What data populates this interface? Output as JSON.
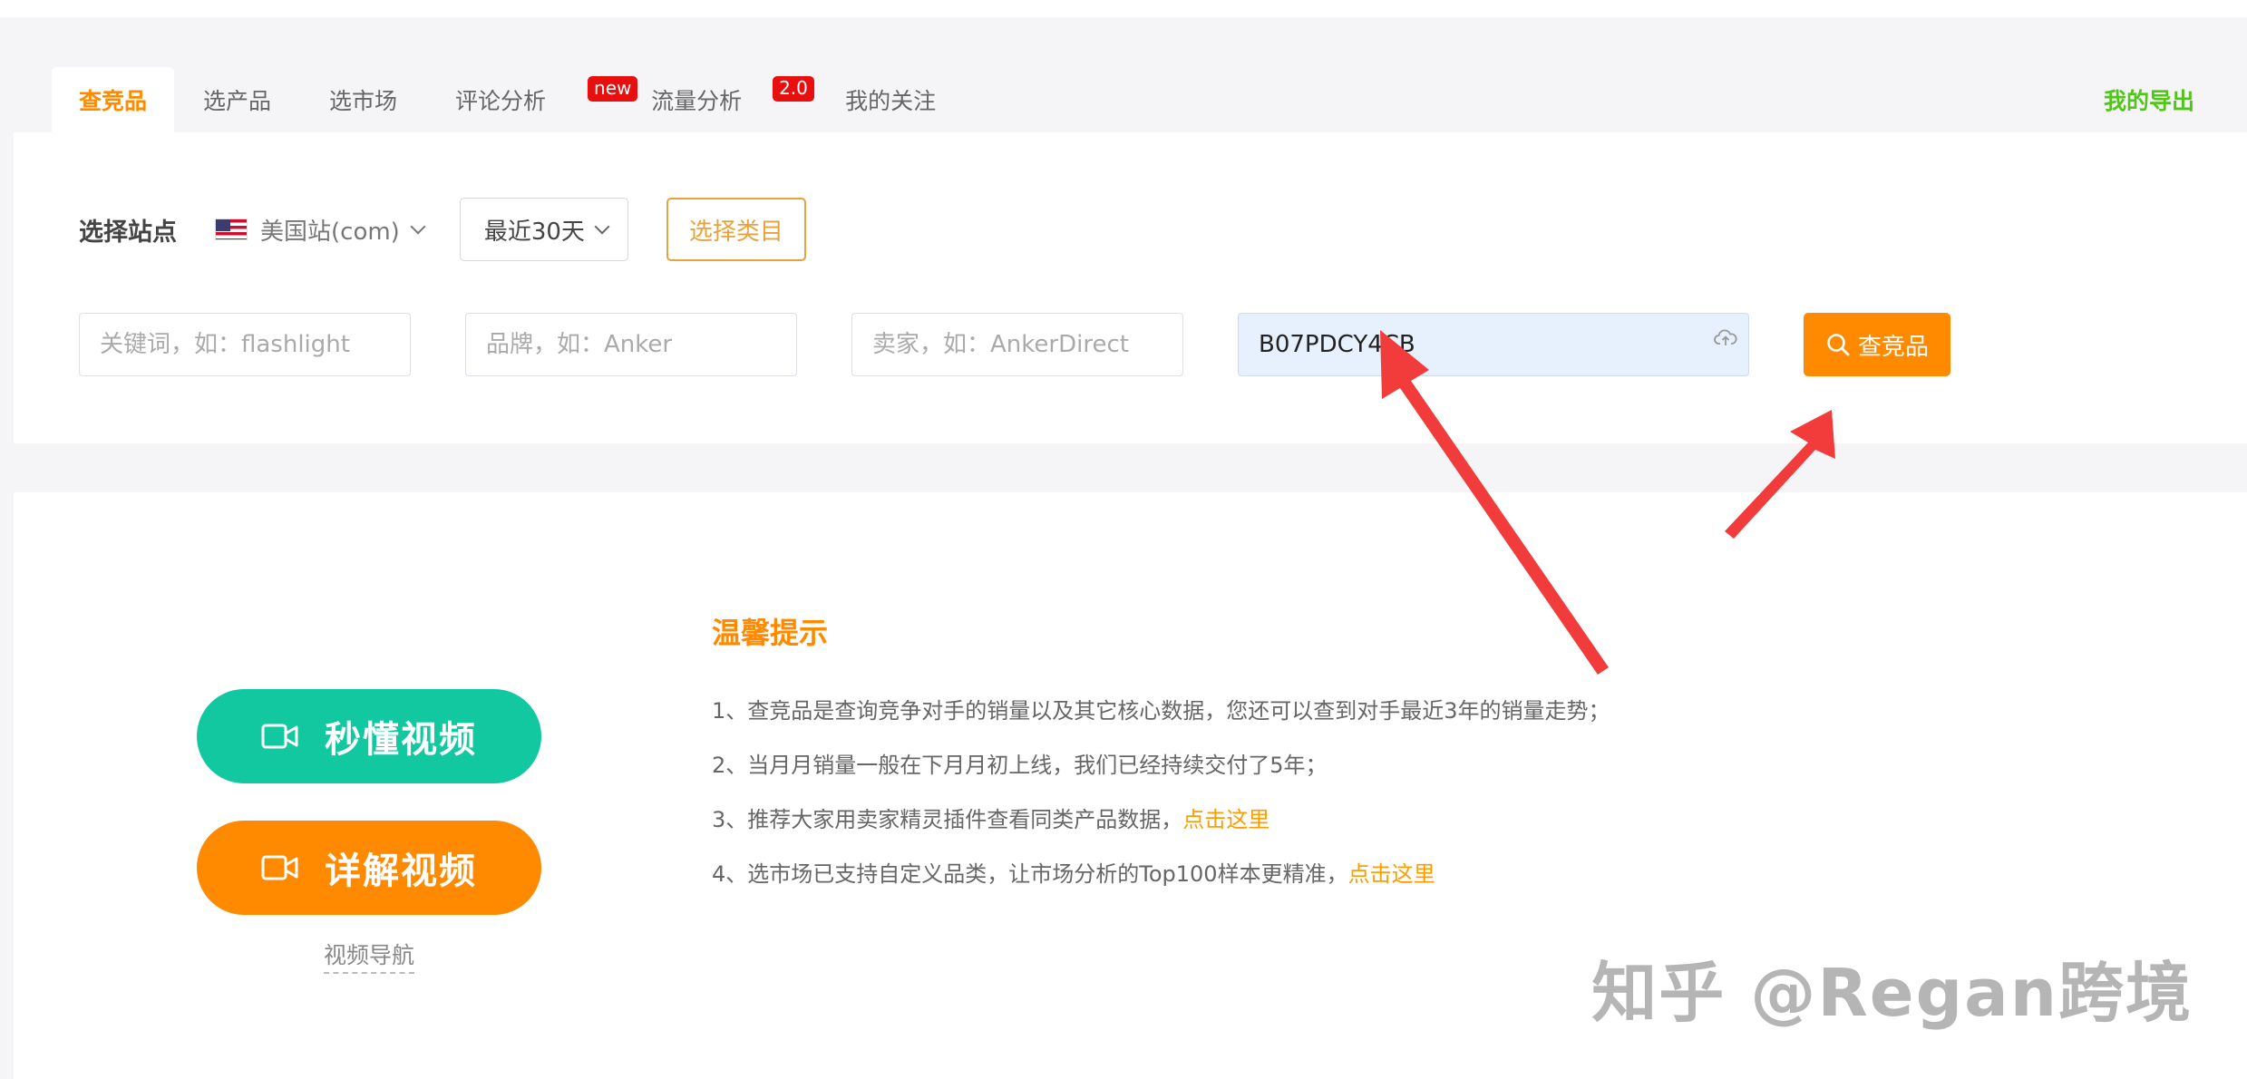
{
  "tabs": [
    {
      "label": "查竞品",
      "active": true
    },
    {
      "label": "选产品"
    },
    {
      "label": "选市场"
    },
    {
      "label": "评论分析",
      "badge": "new"
    },
    {
      "label": "流量分析",
      "badge": "2.0"
    },
    {
      "label": "我的关注"
    }
  ],
  "export_label": "我的导出",
  "filters": {
    "site_label": "选择站点",
    "site_value": "美国站(com)",
    "period_value": "最近30天",
    "category_button": "选择类目"
  },
  "inputs": {
    "keyword_placeholder": "关键词，如：flashlight",
    "brand_placeholder": "品牌，如：Anker",
    "seller_placeholder": "卖家，如：AnkerDirect",
    "asin_value": "B07PDCY4CB"
  },
  "search_button": "查竞品",
  "videos": {
    "quick": "秒懂视频",
    "detail": "详解视频",
    "nav": "视频导航"
  },
  "tips": {
    "title": "温馨提示",
    "items": [
      {
        "text": "1、查竞品是查询竞争对手的销量以及其它核心数据，您还可以查到对手最近3年的销量走势；"
      },
      {
        "text": "2、当月月销量一般在下月月初上线，我们已经持续交付了5年；"
      },
      {
        "text": "3、推荐大家用卖家精灵插件查看同类产品数据，",
        "link": "点击这里"
      },
      {
        "text": "4、选市场已支持自定义品类，让市场分析的Top100样本更精准，",
        "link": "点击这里"
      }
    ]
  },
  "watermark": "知乎 @Regan跨境",
  "colors": {
    "accent": "#ff8a00",
    "teal": "#12c8a0",
    "export_green": "#52c41a",
    "badge_red": "#e8100f",
    "arrow_red": "#f23b3b"
  }
}
